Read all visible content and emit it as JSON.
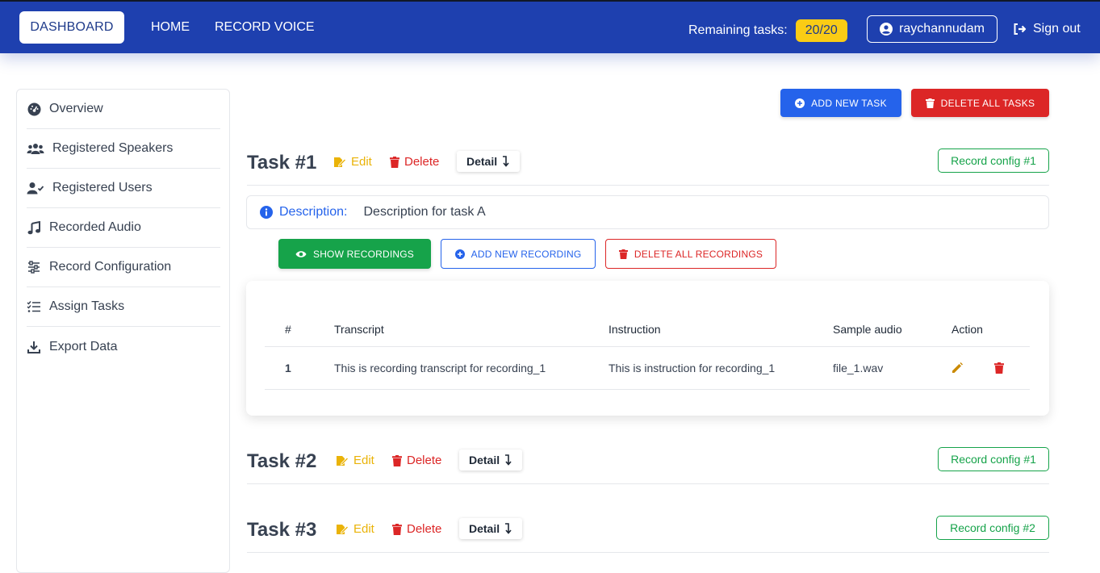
{
  "nav": {
    "dashboard": "DASHBOARD",
    "home": "HOME",
    "record_voice": "RECORD VOICE",
    "remaining_label": "Remaining tasks:",
    "remaining_value": "20/20",
    "username": "raychannudam",
    "signout": "Sign out"
  },
  "sidebar": {
    "items": [
      {
        "label": "Overview",
        "icon": "dashboard-gauge-icon"
      },
      {
        "label": "Registered Speakers",
        "icon": "users-icon"
      },
      {
        "label": "Registered Users",
        "icon": "user-check-icon"
      },
      {
        "label": "Recorded Audio",
        "icon": "music-note-icon"
      },
      {
        "label": "Record Configuration",
        "icon": "sliders-icon"
      },
      {
        "label": "Assign Tasks",
        "icon": "list-check-icon"
      },
      {
        "label": "Export Data",
        "icon": "download-icon"
      }
    ]
  },
  "actions": {
    "add_task": "ADD NEW TASK",
    "delete_all_tasks": "DELETE ALL TASKS"
  },
  "tasks": [
    {
      "title": "Task #1",
      "edit": "Edit",
      "delete": "Delete",
      "detail": "Detail",
      "config": "Record config #1"
    },
    {
      "title": "Task #2",
      "edit": "Edit",
      "delete": "Delete",
      "detail": "Detail",
      "config": "Record config #1"
    },
    {
      "title": "Task #3",
      "edit": "Edit",
      "delete": "Delete",
      "detail": "Detail",
      "config": "Record config #2"
    }
  ],
  "description": {
    "label": "Description:",
    "value": "Description for task A"
  },
  "recording_actions": {
    "show": "SHOW RECORDINGS",
    "add": "ADD NEW RECORDING",
    "delete_all": "DELETE ALL RECORDINGS"
  },
  "recordings": {
    "headers": [
      "#",
      "Transcript",
      "Instruction",
      "Sample audio",
      "Action"
    ],
    "rows": [
      {
        "num": "1",
        "transcript": "This is recording transcript for recording_1",
        "instruction": "This is instruction for recording_1",
        "audio": "file_1.wav"
      }
    ]
  },
  "colors": {
    "nav_bg": "#1e40af",
    "primary": "#2563eb",
    "danger": "#dc2626",
    "success": "#16a34a",
    "warning": "#eab308"
  }
}
